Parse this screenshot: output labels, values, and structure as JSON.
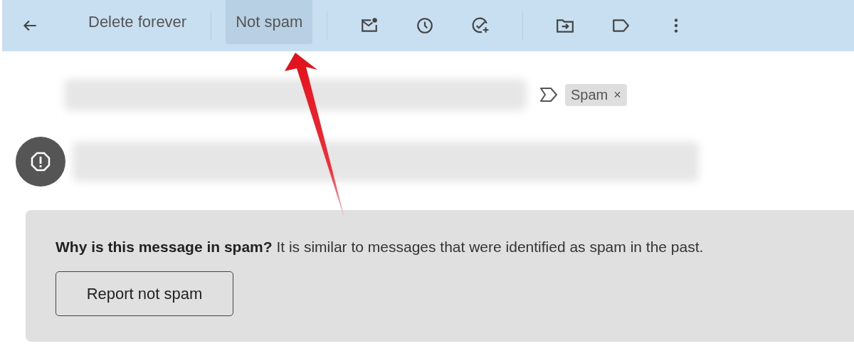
{
  "toolbar": {
    "actions": [
      {
        "kind": "back"
      },
      {
        "kind": "text",
        "label": "Delete forever",
        "selected": false
      },
      {
        "kind": "divider"
      },
      {
        "kind": "text",
        "label": "Not spam",
        "selected": true
      },
      {
        "kind": "divider"
      },
      {
        "kind": "mark-unread"
      },
      {
        "kind": "snooze"
      },
      {
        "kind": "add-task"
      },
      {
        "kind": "divider"
      },
      {
        "kind": "move"
      },
      {
        "kind": "label"
      },
      {
        "kind": "more"
      }
    ]
  },
  "subject": {
    "label_chip": {
      "label": "Spam",
      "remove": "×"
    }
  },
  "notice": {
    "text": "**Why is this message in spam?** It is similar to messages that were identified as spam in the past.",
    "button": "Report not spam"
  }
}
